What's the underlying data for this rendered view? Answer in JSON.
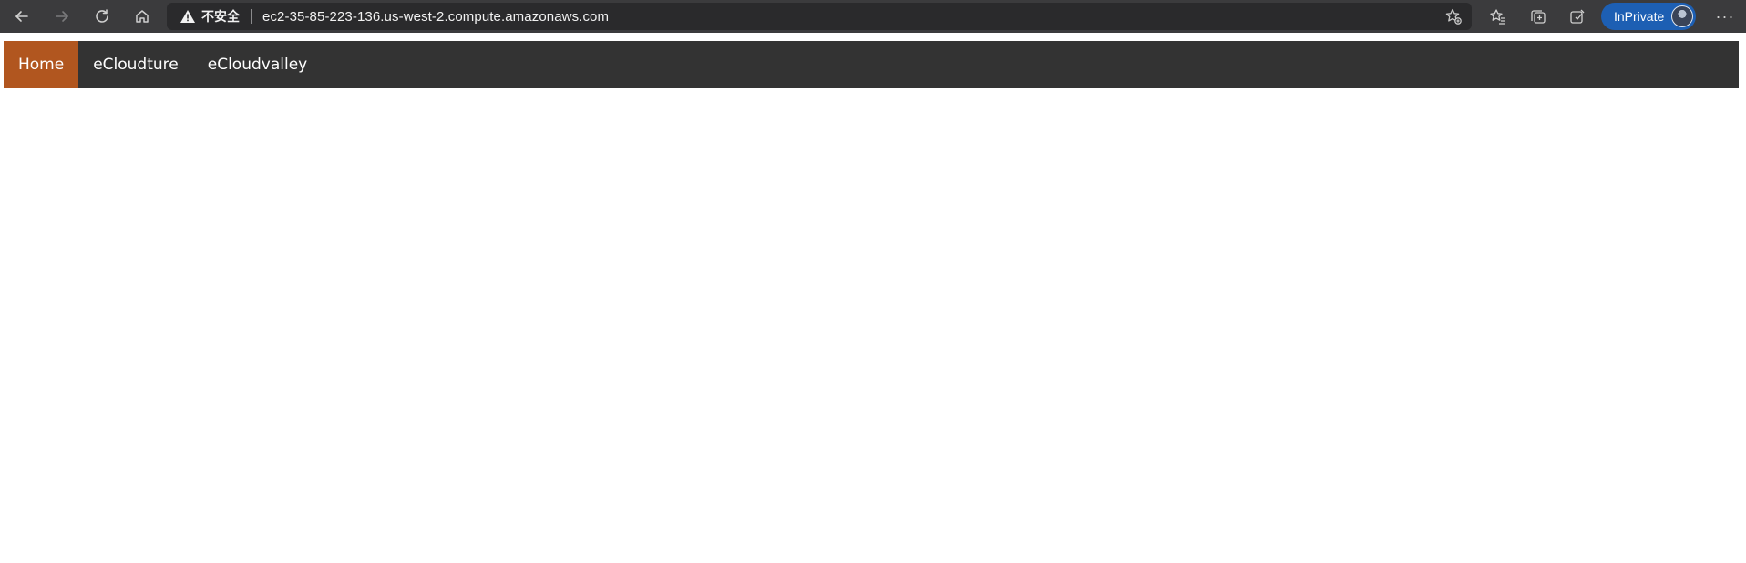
{
  "browser": {
    "security_label": "不安全",
    "url": "ec2-35-85-223-136.us-west-2.compute.amazonaws.com",
    "inprivate_label": "InPrivate",
    "more_label": "···",
    "icons": [
      "back-icon",
      "forward-icon",
      "refresh-icon",
      "home-icon",
      "warning-icon",
      "add-favorite-icon",
      "favorites-icon",
      "collections-icon",
      "extensions-icon",
      "profile-avatar",
      "more-icon"
    ]
  },
  "site_nav": {
    "items": [
      {
        "label": "Home",
        "active": true
      },
      {
        "label": "eCloudture",
        "active": false
      },
      {
        "label": "eCloudvalley",
        "active": false
      }
    ],
    "colors": {
      "background": "#333333",
      "active_background": "#b1561f",
      "text": "#ffffff"
    }
  }
}
